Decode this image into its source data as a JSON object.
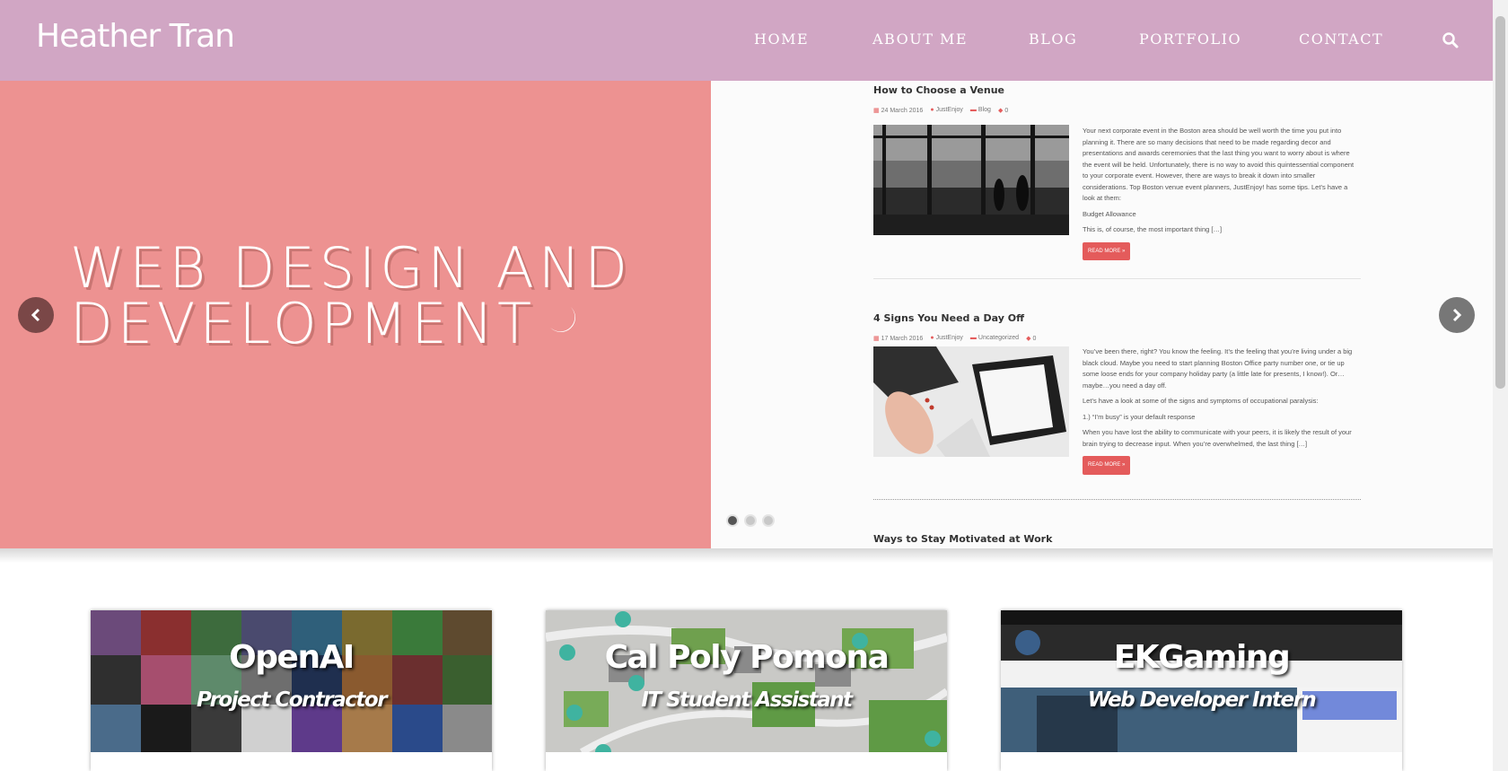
{
  "header": {
    "logo": "Heather Tran",
    "nav": [
      "HOME",
      "ABOUT ME",
      "BLOG",
      "PORTFOLIO",
      "CONTACT"
    ],
    "search_icon": "search-icon"
  },
  "hero": {
    "title_line1": "WEB DESIGN AND",
    "title_line2": "DEVELOPMENT",
    "left_bg": "#ed9291",
    "slide_count": 3,
    "active_slide": 1,
    "posts": [
      {
        "title": "How to Choose a Venue",
        "date": "24 March 2016",
        "author": "JustEnjoy",
        "category": "Blog",
        "comments": "0",
        "paragraphs": [
          "Your next corporate event in the Boston area should be well worth the time you put into planning it. There are so many decisions that need to be made regarding decor and presentations and awards ceremonies that the last thing you want to worry about is where the event will be held. Unfortunately, there is no way to avoid this quintessential component to your corporate event. However, there are ways to break it down into smaller considerations. Top Boston venue event planners, JustEnjoy! has some tips. Let’s have a look at them:",
          "Budget Allowance",
          "This is, of course, the most important thing […]"
        ],
        "read_more": "READ MORE »"
      },
      {
        "title": "4 Signs You Need a Day Off",
        "date": "17 March 2016",
        "author": "JustEnjoy",
        "category": "Uncategorized",
        "comments": "0",
        "paragraphs": [
          "You’ve been there, right? You know the feeling. It’s the feeling that you’re living under a big black cloud. Maybe you need to start planning Boston Office party number one, or tie up some loose ends for your company holiday party (a little late for presents, I know!). Or… maybe…you need a day off.",
          "Let’s have a look at some of the signs and symptoms of occupational paralysis:",
          "1.) “I’m busy” is your default response",
          "When you have lost the ability to communicate with your peers, it is likely the result of your brain trying to decrease input. When you’re overwhelmed, the last thing […]"
        ],
        "read_more": "READ MORE »"
      },
      {
        "title": "Ways to Stay Motivated at Work"
      }
    ]
  },
  "cards": [
    {
      "title": "OpenAI",
      "subtitle": "Project Contractor"
    },
    {
      "title": "Cal Poly Pomona",
      "subtitle": "IT Student Assistant"
    },
    {
      "title": "EKGaming",
      "subtitle": "Web Developer Intern"
    }
  ]
}
